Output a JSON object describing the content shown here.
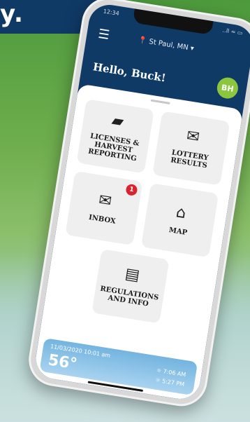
{
  "banner": {
    "text": "y."
  },
  "phone": {
    "status": {
      "time": "12:34",
      "icons": "..ll ≈ ▭"
    },
    "header": {
      "location": "St Paul, MN",
      "greeting": "Hello, Buck!",
      "avatar_initials": "BH"
    },
    "tiles": [
      {
        "label": "LICENSES &\nHARVEST\nREPORTING",
        "icon": "licenses-icon",
        "glyph": "🗂"
      },
      {
        "label": "LOTTERY\nRESULTS",
        "icon": "lottery-icon",
        "glyph": "✉"
      },
      {
        "label": "INBOX",
        "icon": "inbox-icon",
        "glyph": "✉",
        "badge": "1"
      },
      {
        "label": "MAP",
        "icon": "map-icon",
        "glyph": "🗺"
      },
      {
        "label": "REGULATIONS\nAND INFO",
        "icon": "regulations-icon",
        "glyph": "📄"
      }
    ],
    "weather": {
      "datetime": "11/03/2020 10:01 am",
      "temperature": "56°",
      "sunrise": "7:06 AM",
      "sunset": "5:27 PM"
    }
  }
}
